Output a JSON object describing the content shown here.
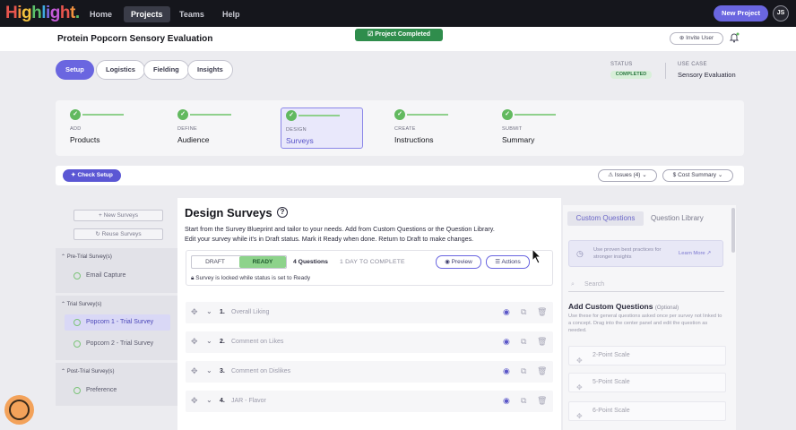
{
  "app": {
    "logo": "Highlight."
  },
  "nav": {
    "items": [
      {
        "label": "Home"
      },
      {
        "label": "Projects"
      },
      {
        "label": "Teams"
      },
      {
        "label": "Help"
      }
    ],
    "new_project": "New Project",
    "avatar": "JS"
  },
  "project": {
    "title": "Protein Popcorn Sensory Evaluation",
    "completed_pill": "Project Completed",
    "invite": "Invite User"
  },
  "tabs": [
    {
      "label": "Setup"
    },
    {
      "label": "Logistics"
    },
    {
      "label": "Fielding"
    },
    {
      "label": "Insights"
    }
  ],
  "status": {
    "label": "STATUS",
    "value": "COMPLETED",
    "usecase_label": "USE CASE",
    "usecase_value": "Sensory Evaluation"
  },
  "steps": [
    {
      "sub": "ADD",
      "main": "Products"
    },
    {
      "sub": "DEFINE",
      "main": "Audience"
    },
    {
      "sub": "DESIGN",
      "main": "Surveys"
    },
    {
      "sub": "CREATE",
      "main": "Instructions"
    },
    {
      "sub": "SUBMIT",
      "main": "Summary"
    }
  ],
  "checkbar": {
    "check_setup": "Check Setup",
    "issues": "Issues (4)",
    "cost_summary": "Cost Summary"
  },
  "sidebar": {
    "new_surveys": "+ New Surveys",
    "reuse_surveys": "Reuse Surveys",
    "groups": [
      {
        "title": "Pre-Trial Survey(s)",
        "items": [
          "Email Capture"
        ]
      },
      {
        "title": "Trial Survey(s)",
        "items": [
          "Popcorn 1 - Trial Survey",
          "Popcorn 2 - Trial Survey"
        ]
      },
      {
        "title": "Post-Trial Survey(s)",
        "items": [
          "Preference"
        ]
      }
    ]
  },
  "main": {
    "title": "Design Surveys",
    "desc1": "Start from the Survey Blueprint and tailor to your needs. Add from Custom Questions or the Question Library.",
    "desc2": "Edit your survey while it's in Draft status. Mark it Ready when done. Return to Draft to make changes.",
    "draft": "DRAFT",
    "ready": "READY",
    "question_count": "4 Questions",
    "days": "1 DAY TO COMPLETE",
    "preview": "Preview",
    "actions": "Actions",
    "lock_text": "Survey is locked while status is set to Ready",
    "questions": [
      {
        "num": "1.",
        "label": "Overall Liking"
      },
      {
        "num": "2.",
        "label": "Comment on Likes"
      },
      {
        "num": "3.",
        "label": "Comment on Dislikes"
      },
      {
        "num": "4.",
        "label": "JAR - Flavor"
      }
    ]
  },
  "right": {
    "tab_custom": "Custom Questions",
    "tab_library": "Question Library",
    "tip": "Use proven best practices for stronger insights",
    "learn_more": "Learn More",
    "search_placeholder": "Search",
    "add_title": "Add Custom Questions",
    "add_optional": "(Optional)",
    "add_desc": "Use these for general questions asked once per survey not linked to a concept. Drag into the center panel and edit the question as needed.",
    "types": [
      "2-Point Scale",
      "5-Point Scale",
      "6-Point Scale"
    ]
  }
}
